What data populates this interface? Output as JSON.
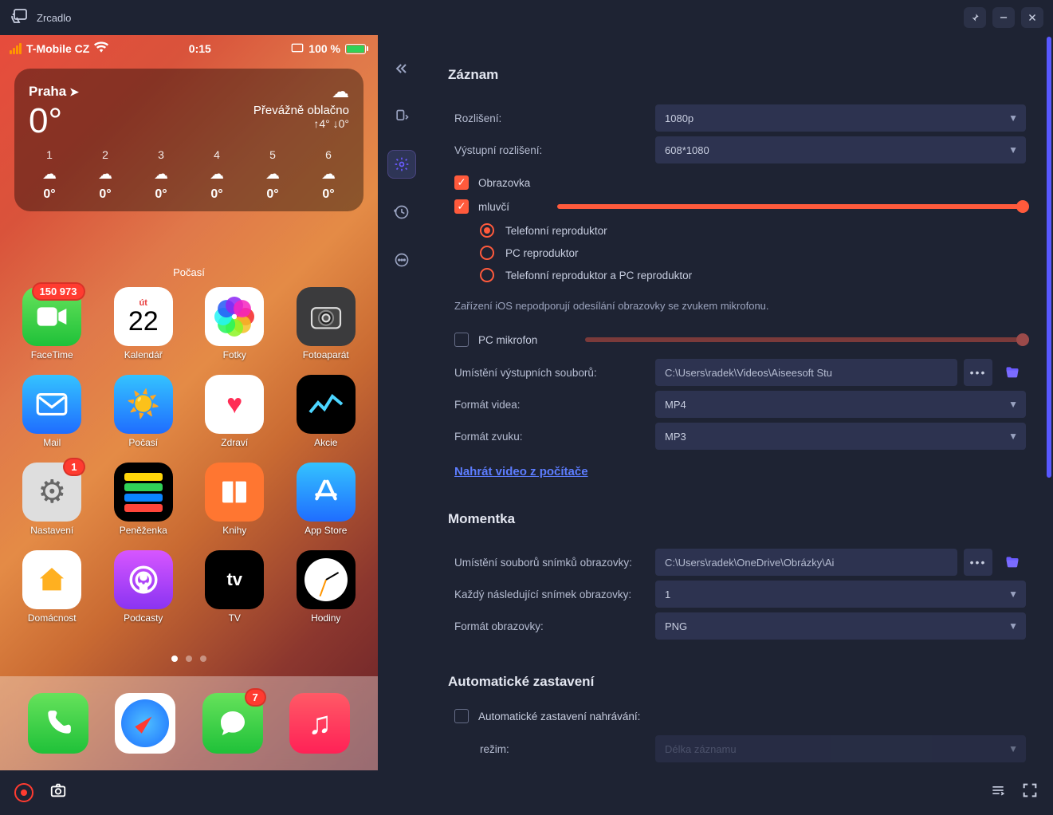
{
  "titlebar": {
    "title": "Zrcadlo"
  },
  "phone": {
    "carrier": "T-Mobile CZ",
    "time": "0:15",
    "battery_pct": "100 %",
    "weather": {
      "city": "Praha",
      "temp": "0°",
      "condition": "Převážně oblačno",
      "hi_lo": "↑4° ↓0°",
      "hours": [
        {
          "h": "1",
          "t": "0°"
        },
        {
          "h": "2",
          "t": "0°"
        },
        {
          "h": "3",
          "t": "0°"
        },
        {
          "h": "4",
          "t": "0°"
        },
        {
          "h": "5",
          "t": "0°"
        },
        {
          "h": "6",
          "t": "0°"
        }
      ],
      "widget_label": "Počasí"
    },
    "apps": [
      {
        "label": "FaceTime",
        "cls": "bg-facetime",
        "badge": "150 973"
      },
      {
        "label": "Kalendář",
        "cls": "bg-calendar",
        "cal_day": "út",
        "cal_num": "22"
      },
      {
        "label": "Fotky",
        "cls": "bg-photos"
      },
      {
        "label": "Fotoaparát",
        "cls": "bg-camera"
      },
      {
        "label": "Mail",
        "cls": "bg-mail"
      },
      {
        "label": "Počasí",
        "cls": "bg-weather"
      },
      {
        "label": "Zdraví",
        "cls": "bg-health"
      },
      {
        "label": "Akcie",
        "cls": "bg-stocks"
      },
      {
        "label": "Nastavení",
        "cls": "bg-settings",
        "badge": "1"
      },
      {
        "label": "Peněženka",
        "cls": "bg-wallet"
      },
      {
        "label": "Knihy",
        "cls": "bg-books"
      },
      {
        "label": "App Store",
        "cls": "bg-appstore"
      },
      {
        "label": "Domácnost",
        "cls": "bg-home"
      },
      {
        "label": "Podcasty",
        "cls": "bg-podcasts"
      },
      {
        "label": "TV",
        "cls": "bg-tv"
      },
      {
        "label": "Hodiny",
        "cls": "bg-clock"
      }
    ],
    "dock": [
      {
        "cls": "bg-phone"
      },
      {
        "cls": "bg-safari"
      },
      {
        "cls": "bg-messages",
        "badge": "7"
      },
      {
        "cls": "bg-music"
      }
    ]
  },
  "record": {
    "section_title": "Záznam",
    "resolution_label": "Rozlišení:",
    "resolution_value": "1080p",
    "output_res_label": "Výstupní rozlišení:",
    "output_res_value": "608*1080",
    "screen_label": "Obrazovka",
    "speaker_label": "mluvčí",
    "speaker_options": {
      "phone": "Telefonní reproduktor",
      "pc": "PC reproduktor",
      "both": "Telefonní reproduktor a PC reproduktor"
    },
    "mic_warning": "Zařízení iOS nepodporují odesílání obrazovky se zvukem mikrofonu.",
    "pc_mic_label": "PC mikrofon",
    "output_location_label": "Umístění výstupních souborů:",
    "output_location_value": "C:\\Users\\radek\\Videos\\Aiseesoft Stu",
    "video_format_label": "Formát videa:",
    "video_format_value": "MP4",
    "audio_format_label": "Formát zvuku:",
    "audio_format_value": "MP3",
    "upload_link": "Nahrát video z počítače"
  },
  "snapshot": {
    "section_title": "Momentka",
    "location_label": "Umístění souborů snímků obrazovky:",
    "location_value": "C:\\Users\\radek\\OneDrive\\Obrázky\\Ai",
    "interval_label": "Každý následující snímek obrazovky:",
    "interval_value": "1",
    "format_label": "Formát obrazovky:",
    "format_value": "PNG"
  },
  "autostop": {
    "section_title": "Automatické zastavení",
    "checkbox_label": "Automatické zastavení nahrávání:",
    "mode_label": "režim:",
    "mode_value": "Délka záznamu"
  }
}
